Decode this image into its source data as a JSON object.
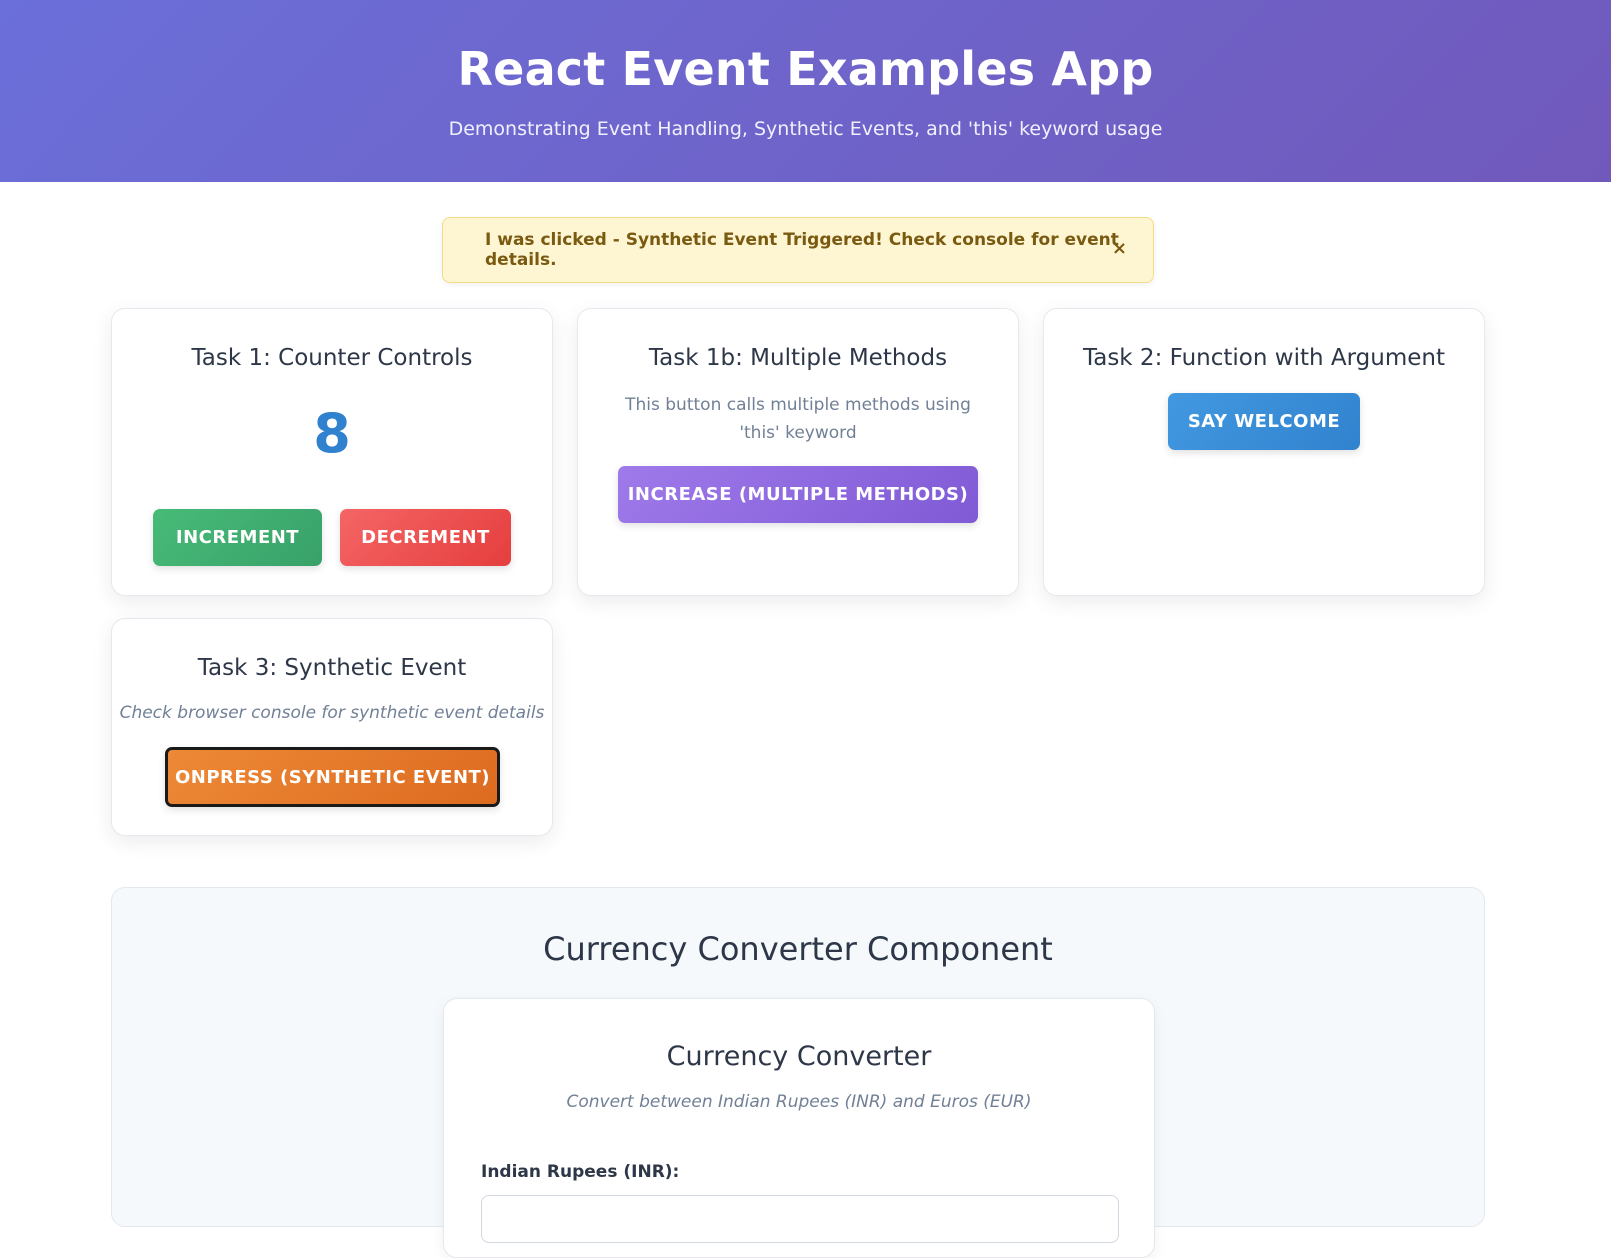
{
  "header": {
    "title": "React Event Examples App",
    "subtitle": "Demonstrating Event Handling, Synthetic Events, and 'this' keyword usage"
  },
  "alert": {
    "message": "I was clicked - Synthetic Event Triggered! Check console for event details.",
    "close_symbol": "×"
  },
  "task1": {
    "title": "Task 1: Counter Controls",
    "count": "8",
    "increment_label": "INCREMENT",
    "decrement_label": "DECREMENT"
  },
  "task1b": {
    "title": "Task 1b: Multiple Methods",
    "description": "This button calls multiple methods using 'this' keyword",
    "button_label": "INCREASE (MULTIPLE METHODS)"
  },
  "task2": {
    "title": "Task 2: Function with Argument",
    "button_label": "SAY WELCOME"
  },
  "task3": {
    "title": "Task 3: Synthetic Event",
    "description": "Check browser console for synthetic event details",
    "button_label": "ONPRESS (SYNTHETIC EVENT)"
  },
  "currency": {
    "section_title": "Currency Converter Component",
    "card_title": "Currency Converter",
    "card_subtitle": "Convert between Indian Rupees (INR) and Euros (EUR)",
    "inr_label": "Indian Rupees (INR):",
    "inr_value": ""
  }
}
